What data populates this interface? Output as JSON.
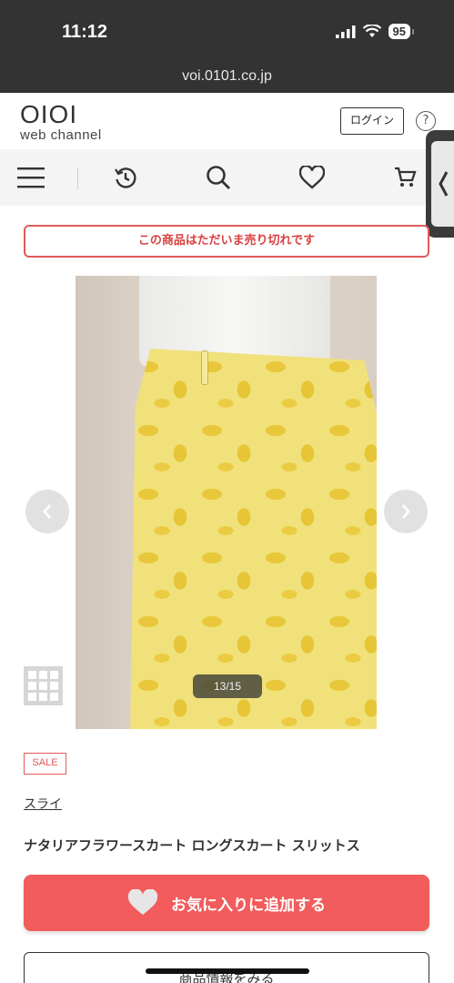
{
  "status_bar": {
    "time": "11:12",
    "battery": "95"
  },
  "browser": {
    "url": "voi.0101.co.jp"
  },
  "header": {
    "logo_mark": "OIOI",
    "logo_sub": "web channel",
    "login_label": "ログイン",
    "help_label": "?"
  },
  "nav": {
    "items": [
      "menu-icon",
      "history-icon",
      "search-icon",
      "favorite-icon",
      "cart-icon"
    ]
  },
  "notice": {
    "sold_out": "この商品はただいま売り切れです"
  },
  "gallery": {
    "counter": "13/15",
    "colors": {
      "skirt": "#f1e17a",
      "pattern": "#e8c83a"
    }
  },
  "product": {
    "badge": "SALE",
    "brand": "スライ",
    "title": "ナタリアフラワースカート ロングスカート スリットス"
  },
  "actions": {
    "favorite_label": "お気に入りに追加する",
    "info_label": "商品情報をみる"
  },
  "colors": {
    "accent": "#f25c5c",
    "sale": "#e05a5a",
    "status_bar": "#333333"
  }
}
